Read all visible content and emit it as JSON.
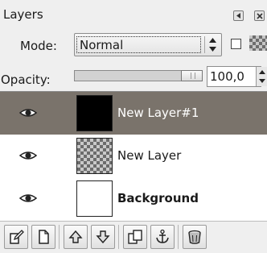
{
  "panel": {
    "title": "Layers"
  },
  "mode": {
    "label": "Mode:",
    "value": "Normal"
  },
  "opacity": {
    "label": "Opacity:",
    "value": "100,0",
    "level_percent": 100
  },
  "layers": [
    {
      "name": "New Layer#1",
      "selected": true,
      "thumbnail": "black",
      "visible": true
    },
    {
      "name": "New Layer",
      "selected": false,
      "thumbnail": "transparent",
      "visible": true
    },
    {
      "name": "Background",
      "selected": false,
      "thumbnail": "white",
      "visible": true
    }
  ],
  "toolbar": {
    "buttons": [
      "new-layer-icon",
      "duplicate-layer-icon",
      "raise-layer-icon",
      "lower-layer-icon",
      "copy-layer-icon",
      "anchor-icon",
      "delete-layer-icon"
    ]
  }
}
